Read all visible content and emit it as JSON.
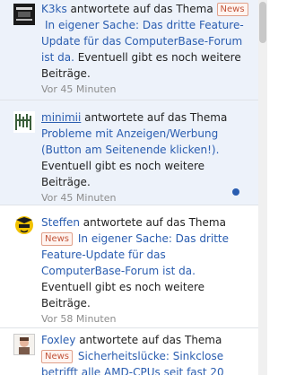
{
  "notifications": [
    {
      "user": "K3ks",
      "action": "antwortete auf das Thema",
      "badge": "News",
      "thread_lines": [
        "In eigener Sache: Das dritte Feature-",
        "Update für das ComputerBase-Forum",
        "ist da."
      ],
      "suffix_lines": [
        "Eventuell gibt es noch weitere",
        "Beiträge."
      ],
      "suffix_first": " Eventuell gibt es noch weitere",
      "suffix_second": "Beiträge.",
      "time": "Vor 45 Minuten",
      "avatar_icon": "k3ks-avatar-icon",
      "state": "unread"
    },
    {
      "user": "minimii",
      "action": "antwortete auf das Thema",
      "thread_lines": [
        "Probleme mit Anzeigen/Werbung",
        "(Button am Seitenende klicken!)."
      ],
      "suffix_lines": [
        "Eventuell gibt es noch weitere",
        "Beiträge."
      ],
      "time": "Vor 45 Minuten",
      "avatar_icon": "minimii-avatar-icon",
      "state": "unread"
    },
    {
      "user": "Steffen",
      "action": "antwortete auf das Thema",
      "badge": "News",
      "thread_lines": [
        "In eigener Sache: Das dritte",
        "Feature-Update für das",
        "ComputerBase-Forum ist da."
      ],
      "suffix_lines": [
        "Eventuell gibt es noch weitere",
        "Beiträge."
      ],
      "time": "Vor 58 Minuten",
      "avatar_icon": "steffen-avatar-icon",
      "state": "read"
    },
    {
      "user": "Foxley",
      "action": "antwortete auf das Thema",
      "badge": "News",
      "thread_lines": [
        "Sicherheitslücke: Sinkclose",
        "betrifft alle AMD-CPUs seit fast 20"
      ],
      "avatar_icon": "foxley-avatar-icon",
      "state": "read"
    }
  ],
  "colors": {
    "link": "#2a5db0",
    "unread_bg": "#edf2fa",
    "badge_text": "#c2553b",
    "dot": "#2a5db0"
  }
}
